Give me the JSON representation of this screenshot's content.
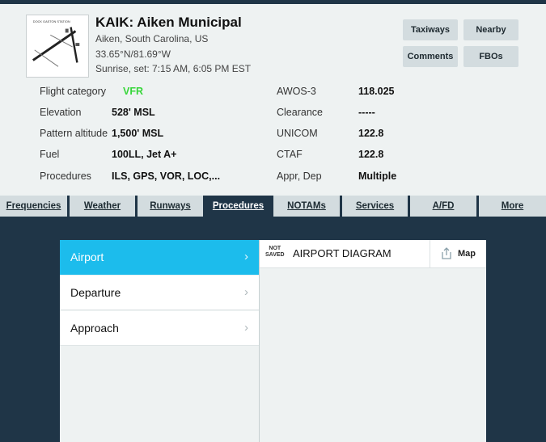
{
  "airport": {
    "title": "KAIK: Aiken Municipal",
    "location": "Aiken, South Carolina, US",
    "coords": "33.65°N/81.69°W",
    "sun": "Sunrise, set: 7:15 AM, 6:05 PM EST",
    "thumb_caption": "DOCK GASTON STATION"
  },
  "actions": {
    "taxiways": "Taxiways",
    "nearby": "Nearby",
    "comments": "Comments",
    "fbos": "FBOs"
  },
  "info": {
    "left": [
      {
        "label": "Flight category",
        "value": "VFR"
      },
      {
        "label": "Elevation",
        "value": "528' MSL"
      },
      {
        "label": "Pattern altitude",
        "value": "1,500' MSL"
      },
      {
        "label": "Fuel",
        "value": "100LL, Jet A+"
      },
      {
        "label": "Procedures",
        "value": "ILS, GPS, VOR, LOC,..."
      }
    ],
    "right": [
      {
        "label": "AWOS-3",
        "value": "118.025"
      },
      {
        "label": "Clearance",
        "value": "-----"
      },
      {
        "label": "UNICOM",
        "value": "122.8"
      },
      {
        "label": "CTAF",
        "value": "122.8"
      },
      {
        "label": "Appr, Dep",
        "value": "Multiple"
      }
    ],
    "vfr_color": "#37d63a"
  },
  "tabs": [
    "Frequencies",
    "Weather",
    "Runways",
    "Procedures",
    "NOTAMs",
    "Services",
    "A/FD",
    "More"
  ],
  "active_tab": "Procedures",
  "procedures": {
    "items": [
      "Airport",
      "Departure",
      "Approach"
    ],
    "active": "Airport",
    "chevron": "›",
    "doc_status": "NOT SAVED",
    "doc_title": "AIRPORT DIAGRAM",
    "map_label": "Map",
    "share_icon": "share-icon",
    "accent_color": "#1cbcec"
  },
  "colors": {
    "background": "#1f3547",
    "header_bg": "#eef2f2",
    "button_bg": "#d3dcdf"
  }
}
